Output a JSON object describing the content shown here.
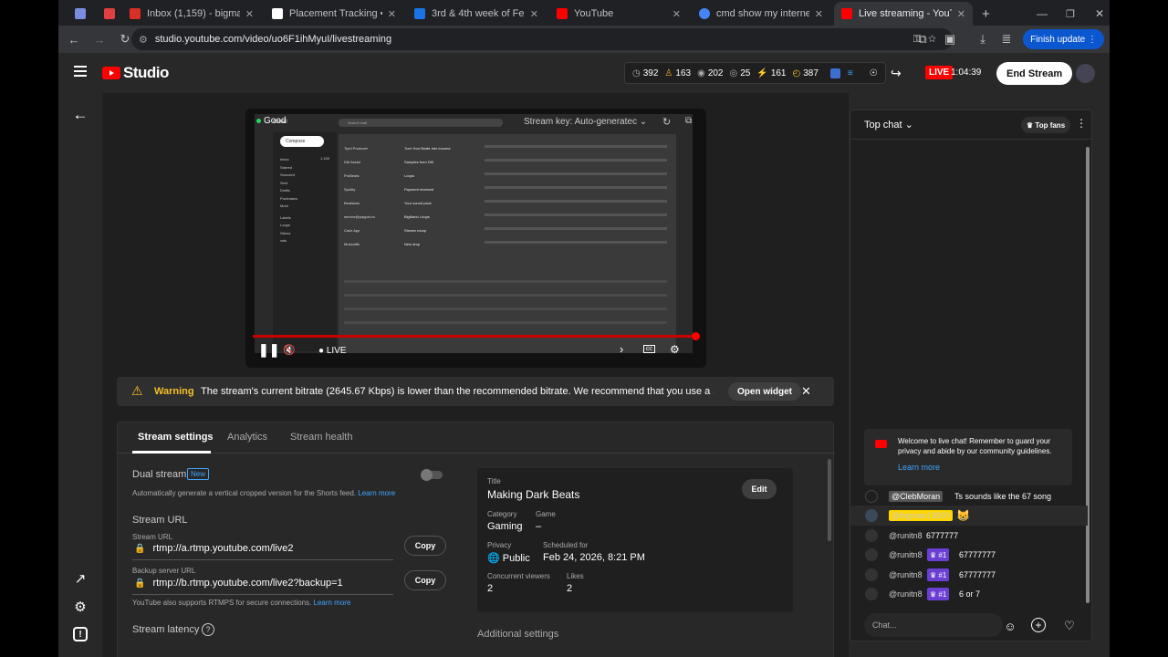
{
  "browser": {
    "tabs": [
      {
        "label": "",
        "color": "#7b8cde"
      },
      {
        "label": "",
        "color": "#e04040"
      },
      {
        "label": "Inbox (1,159) - bigman131300",
        "color": "#d93025"
      },
      {
        "label": "Placement Tracking • ArtistCo",
        "color": "#ffffff"
      },
      {
        "label": "3rd & 4th week of February L",
        "color": "#1a73e8"
      },
      {
        "label": "YouTube",
        "color": "#ff0000"
      },
      {
        "label": "cmd show my internet addres",
        "color": "#4285f4"
      },
      {
        "label": "Live streaming - YouTube Stud",
        "color": "#ff0000"
      }
    ],
    "url": "studio.youtube.com/video/uo6F1ihMyuI/livestreaming",
    "finish_update": "Finish update"
  },
  "header": {
    "logo_text": "Studio",
    "stats": [
      {
        "value": "392",
        "color": "#aaaaaa"
      },
      {
        "value": "163",
        "color": "#f6a623"
      },
      {
        "value": "202",
        "color": "#aaaaaa"
      },
      {
        "value": "25",
        "color": "#aaaaaa"
      },
      {
        "value": "161",
        "color": "#f6c026"
      },
      {
        "value": "387",
        "color": "#f6c026"
      }
    ],
    "live_label": "LIVE",
    "live_time": "1:04:39",
    "end_stream": "End Stream"
  },
  "player": {
    "status": "Good",
    "stream_key": "Stream key: Auto-generatec",
    "live": "LIVE",
    "preview_window": {
      "title": "Gmail",
      "search": "Search mail",
      "compose": "Compose",
      "folders": [
        "Inbox",
        "Starred",
        "Snoozed",
        "Sent",
        "Drafts",
        "Purchases",
        "More"
      ],
      "labels_heading": "Labels",
      "labels": [
        "Loops",
        "Stems",
        "vsts"
      ],
      "inbox_count": "1,159",
      "senders": [
        "Tyrel Producer",
        "DM Assist",
        "ProBeats",
        "Spotify",
        "Beatstars",
        "service@paypal.co",
        "Cash App",
        "Musicaffe"
      ],
      "subjects": [
        "Turn Your Beats Into Income",
        "Samples from DM",
        "Loops",
        "Payment received",
        "Your sound pack",
        "BigMario Loops",
        "Stream recap",
        "New drop"
      ]
    }
  },
  "warning": {
    "label": "Warning",
    "text": "The stream's current bitrate (2645.67 Kbps) is lower than the recommended bitrate. We recommend that you use a s...",
    "button": "Open widget"
  },
  "panel": {
    "tabs": [
      "Stream settings",
      "Analytics",
      "Stream health"
    ],
    "dual_stream": {
      "title": "Dual stream",
      "badge": "New",
      "desc": "Automatically generate a vertical cropped version for the Shorts feed.",
      "learn_more": "Learn more"
    },
    "stream_url": {
      "heading": "Stream URL",
      "url_label": "Stream URL",
      "url": "rtmp://a.rtmp.youtube.com/live2",
      "backup_label": "Backup server URL",
      "backup": "rtmp://b.rtmp.youtube.com/live2?backup=1",
      "copy": "Copy",
      "rtmps_note": "YouTube also supports RTMPS for secure connections.",
      "learn_more": "Learn more"
    },
    "latency_heading": "Stream latency",
    "latency_icon": "?",
    "additional": "Additional settings",
    "details": {
      "title_label": "Title",
      "title": "Making Dark Beats",
      "edit": "Edit",
      "category_label": "Category",
      "category": "Gaming",
      "game_label": "Game",
      "game": "–",
      "privacy_label": "Privacy",
      "privacy": "Public",
      "scheduled_label": "Scheduled for",
      "scheduled": "Feb 24, 2026, 8:21 PM",
      "viewers_label": "Concurrent viewers",
      "viewers": "2",
      "likes_label": "Likes",
      "likes": "2"
    }
  },
  "chat": {
    "title": "Top chat",
    "top_fans": "Top fans",
    "welcome": "Welcome to live chat! Remember to guard your privacy and abide by our community guidelines.",
    "welcome_link": "Learn more",
    "messages": [
      {
        "author": "@ClebMoran",
        "text": "Ts sounds like the 67 song",
        "badge": ""
      },
      {
        "author": "@bigman13000",
        "text": "😸",
        "badge": ""
      },
      {
        "author": "@runitn8",
        "text": "6777777",
        "badge": ""
      },
      {
        "author": "@runitn8",
        "text": "67777777",
        "badge": "#1"
      },
      {
        "author": "@runitn8",
        "text": "67777777",
        "badge": "#1"
      },
      {
        "author": "@runitn8",
        "text": "6 or 7",
        "badge": "#1"
      }
    ],
    "placeholder": "Chat..."
  }
}
